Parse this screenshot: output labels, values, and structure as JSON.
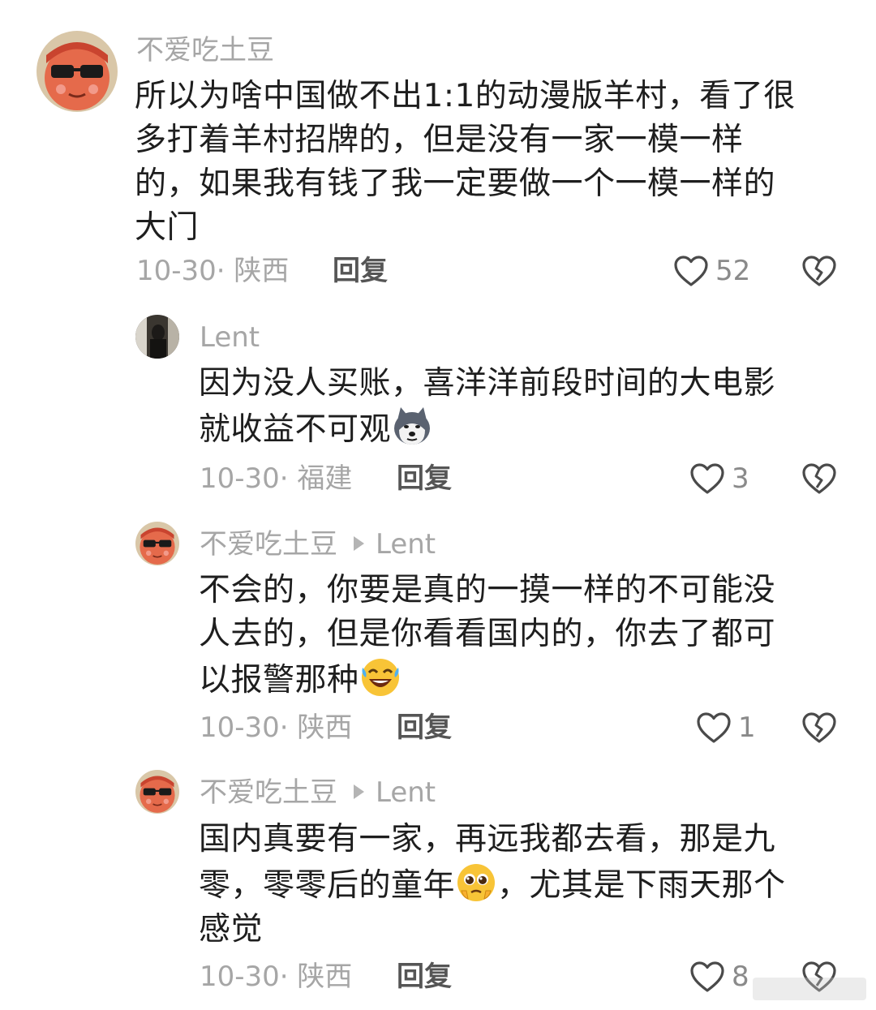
{
  "comments": [
    {
      "username": "不爱吃土豆",
      "reply_to": "",
      "lines": [
        "所以为啥中国做不出1:1的动漫版羊村，看了很",
        "多打着羊村招牌的，但是没有一家一模一样",
        "的，如果我有钱了我一定要做一个一模一样的",
        "大门"
      ],
      "meta": "10-30· 陕西",
      "reply_label": "回复",
      "likes": "52"
    },
    {
      "username": "Lent",
      "reply_to": "",
      "lines": [
        "因为没人买账，喜洋洋前段时间的大电影",
        "就收益不可观"
      ],
      "emoji": "husky-dog-emoji",
      "meta": "10-30· 福建",
      "reply_label": "回复",
      "likes": "3"
    },
    {
      "username": "不爱吃土豆",
      "reply_to": "Lent",
      "lines": [
        "不会的，你要是真的一摸一样的不可能没",
        "人去的，但是你看看国内的，你去了都可",
        "以报警那种"
      ],
      "emoji": "rolling-laughing-emoji",
      "meta": "10-30· 陕西",
      "reply_label": "回复",
      "likes": "1"
    },
    {
      "username": "不爱吃土豆",
      "reply_to": "Lent",
      "lines": [
        "国内真要有一家，再远我都去看，那是九",
        "零，零零后的童年",
        "，尤其是下雨天那个",
        "感觉"
      ],
      "emoji": "pleading-teary-emoji",
      "meta": "10-30· 陕西",
      "reply_label": "回复",
      "likes": "8"
    }
  ],
  "icons": {
    "like": "heart-outline-icon",
    "dislike": "broken-heart-icon",
    "reply_arrow": "triangle-right-icon"
  },
  "colors": {
    "username": "#a6a6a6",
    "text": "#1e1e1e",
    "reply": "#555555"
  }
}
